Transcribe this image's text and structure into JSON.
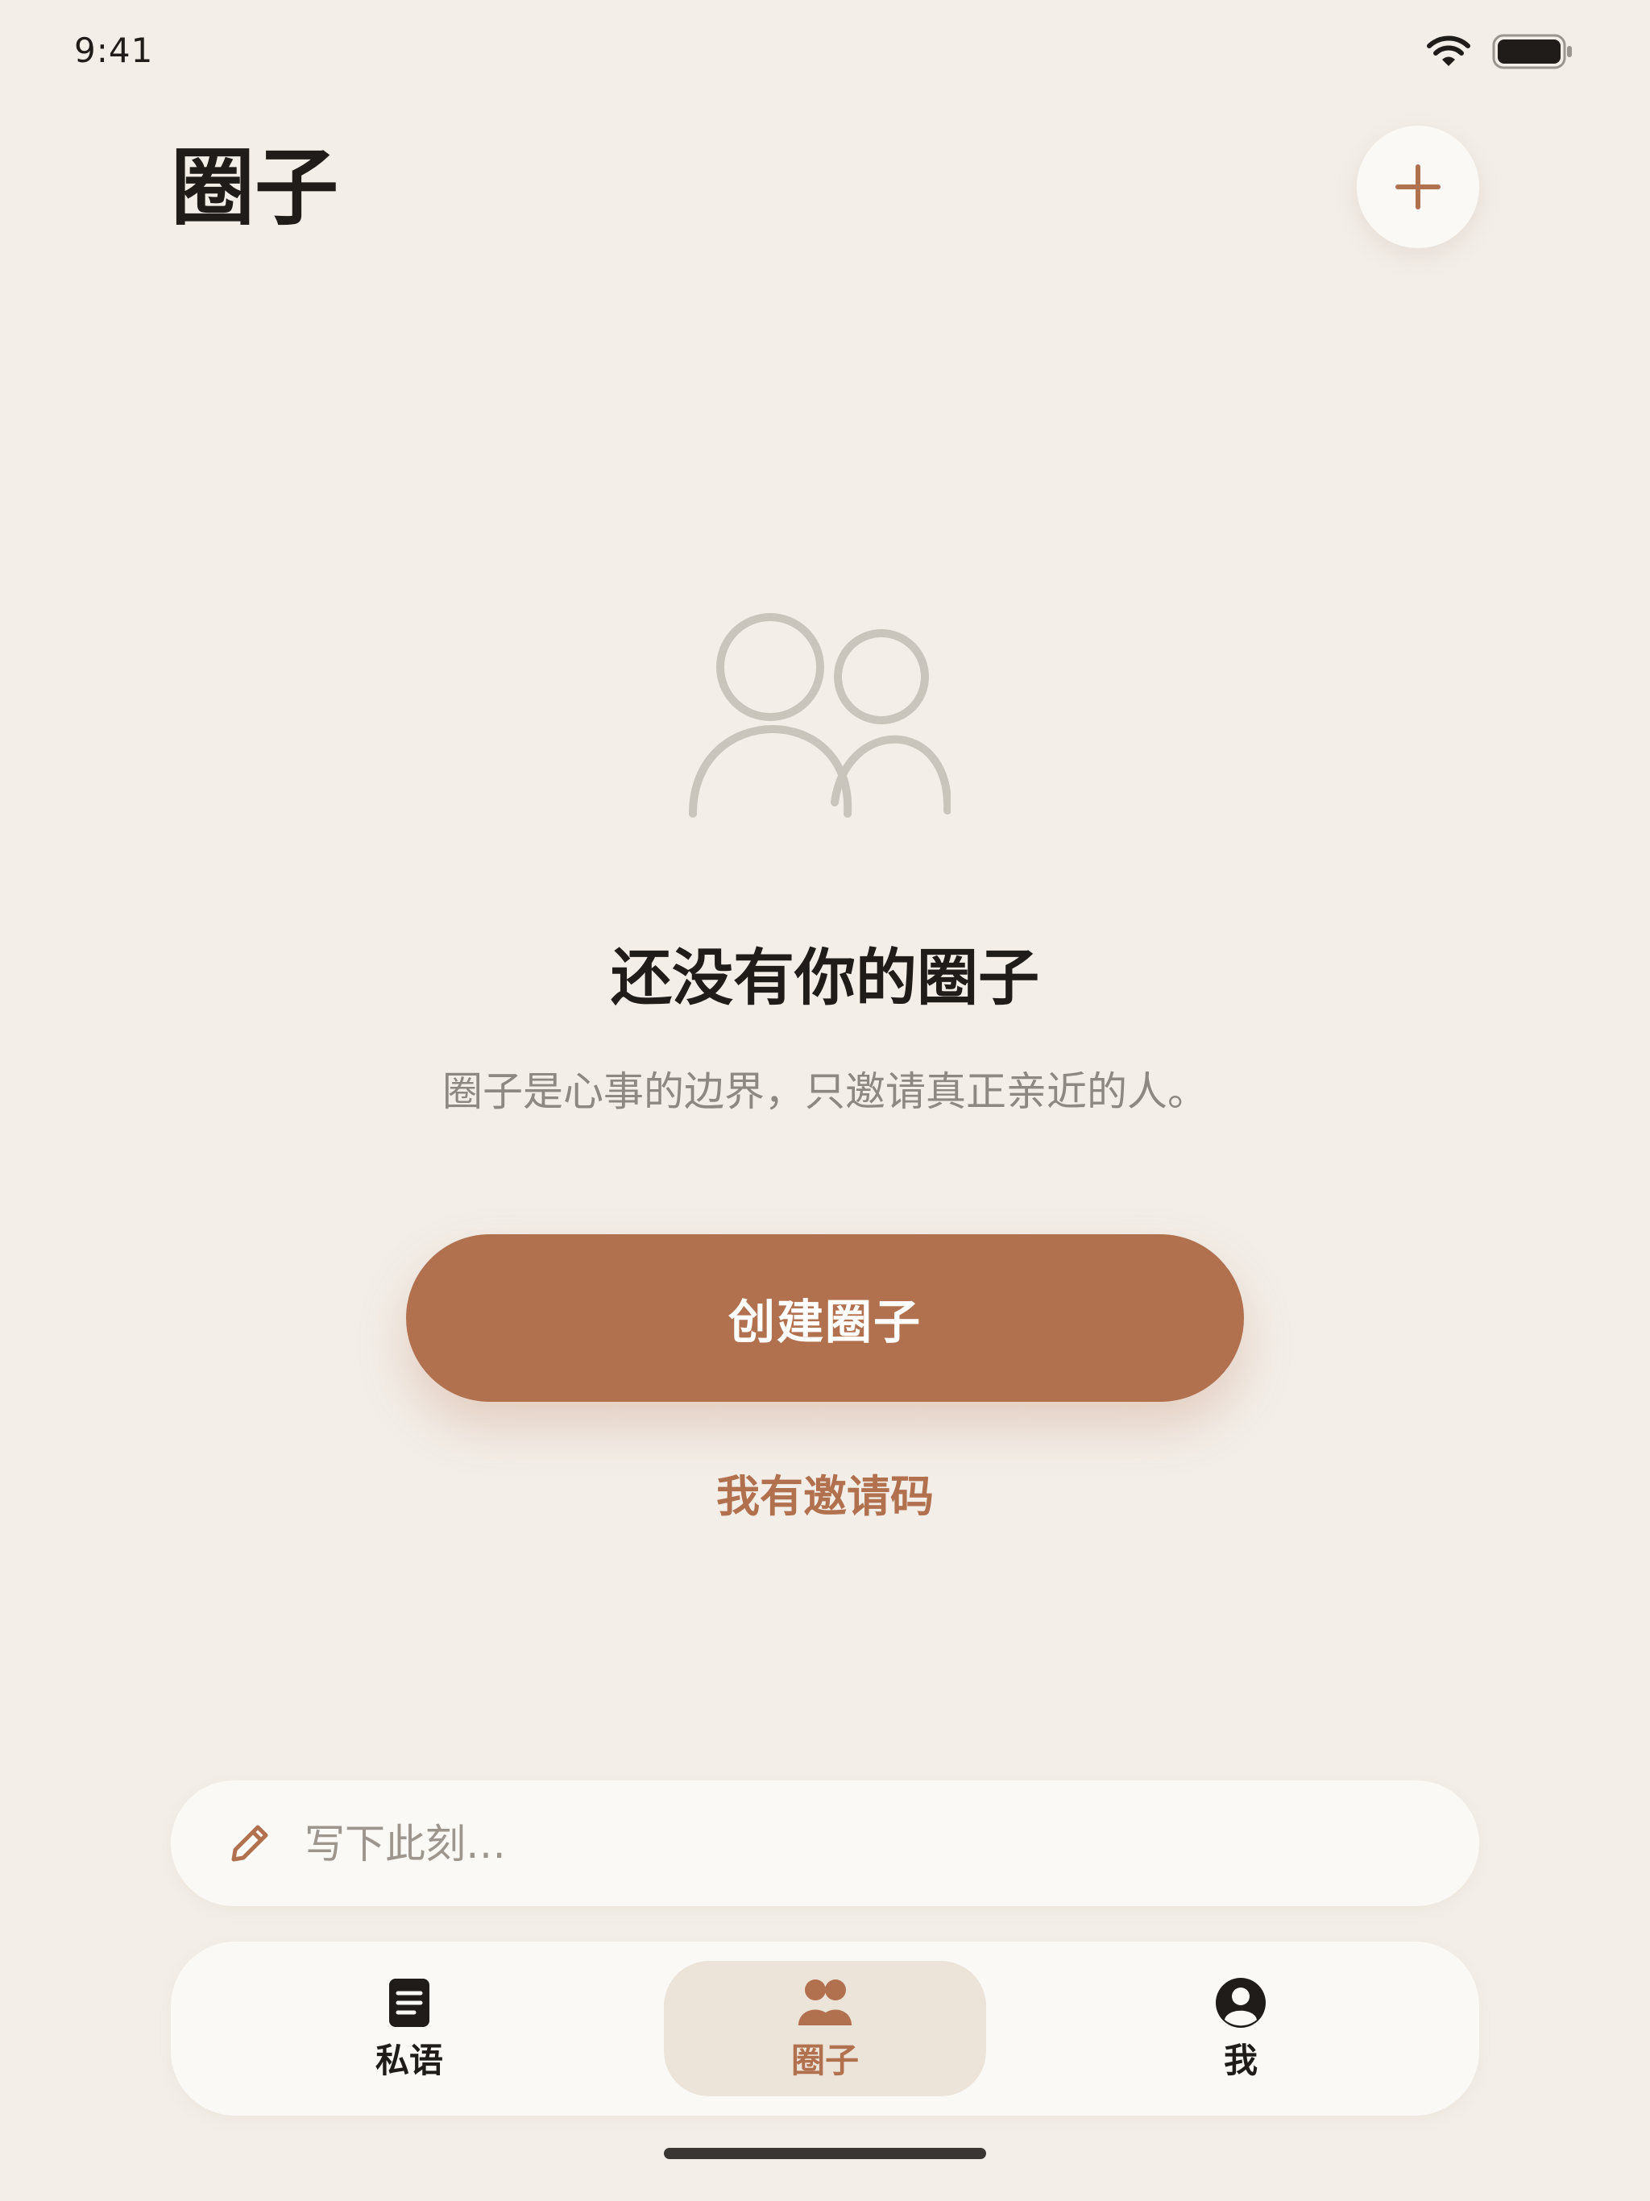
{
  "status_bar": {
    "time": "9:41",
    "wifi_icon": "wifi-icon",
    "battery_icon": "battery-icon"
  },
  "header": {
    "title": "圈子",
    "add_icon": "plus-icon"
  },
  "empty_state": {
    "icon": "people-icon",
    "title": "还没有你的圈子",
    "description": "圈子是心事的边界，只邀请真正亲近的人。",
    "create_button_label": "创建圈子",
    "invite_link_label": "我有邀请码"
  },
  "composer": {
    "icon": "pencil-icon",
    "placeholder": "写下此刻…",
    "value": ""
  },
  "tab_bar": {
    "tabs": [
      {
        "label": "私语",
        "icon": "document-icon",
        "active": false
      },
      {
        "label": "圈子",
        "icon": "people-icon",
        "active": true
      },
      {
        "label": "我",
        "icon": "profile-icon",
        "active": false
      }
    ]
  },
  "colors": {
    "background": "#F3EEE8",
    "accent": "#B2714E",
    "text_primary": "#1F1C1A",
    "text_secondary": "#8E8882",
    "surface": "#FAF9F6",
    "active_tab_bg": "#ECE4D8",
    "illustration": "#C9C4BC"
  }
}
